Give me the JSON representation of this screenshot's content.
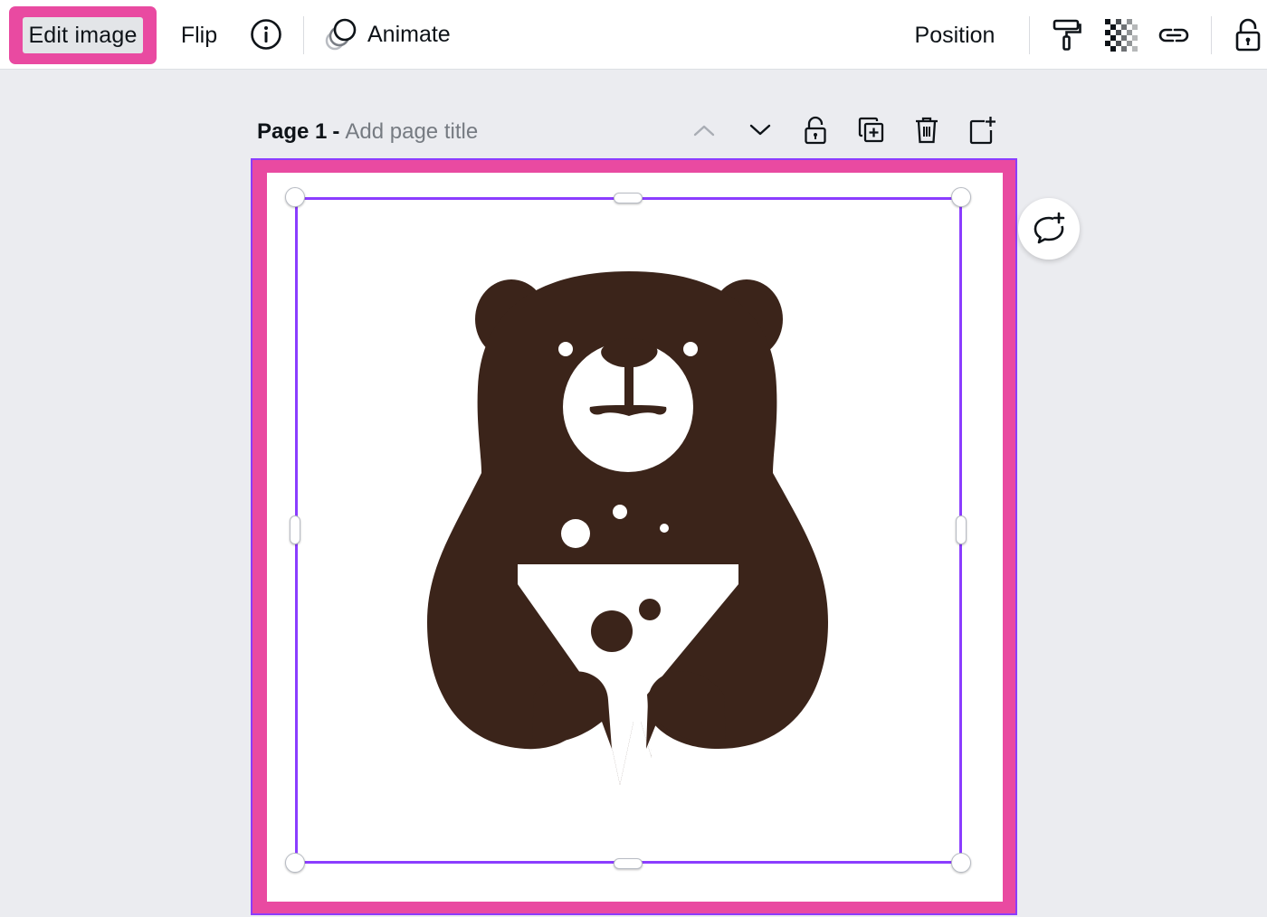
{
  "toolbar": {
    "edit_image_label": "Edit image",
    "flip_label": "Flip",
    "info_icon": "info-icon",
    "animate_icon": "animate-icon",
    "animate_label": "Animate",
    "position_label": "Position",
    "paint_icon": "paint-roller-icon",
    "transparency_icon": "transparency-icon",
    "link_icon": "link-icon",
    "lock_icon": "lock-icon",
    "highlight_color": "#e94aa1"
  },
  "page": {
    "label": "Page 1",
    "separator": "-",
    "title_placeholder": "Add page title",
    "actions": [
      "chevron-up-icon",
      "chevron-down-icon",
      "lock-icon",
      "duplicate-page-icon",
      "trash-icon",
      "add-page-icon"
    ]
  },
  "canvas": {
    "border_color": "#e94aa1",
    "selection_color": "#8b3dff",
    "image_description_icon": "bear-logo",
    "bear_color": "#3b241a"
  },
  "comment_icon": "add-comment-icon"
}
